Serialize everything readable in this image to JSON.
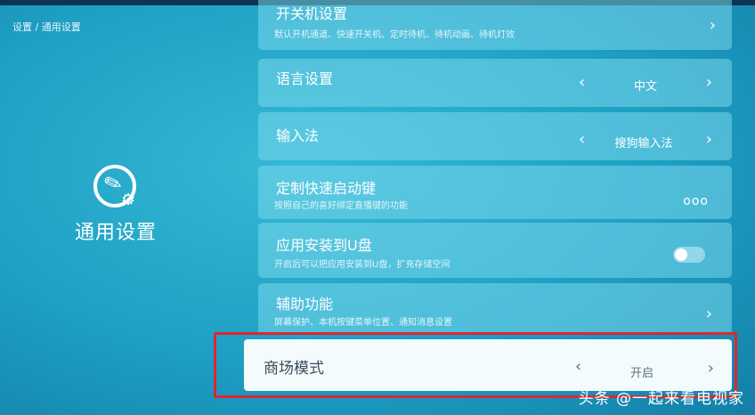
{
  "breadcrumb": "设置 / 通用设置",
  "left_panel": {
    "title": "通用设置",
    "icon": "settings-wrench-gear-icon"
  },
  "items": [
    {
      "title": "开关机设置",
      "subtitle": "默认开机通道、快速开关机、定时待机、待机动画、待机灯效",
      "control": "chevron"
    },
    {
      "title": "语言设置",
      "value": "中文",
      "control": "selector"
    },
    {
      "title": "输入法",
      "value": "搜狗输入法",
      "control": "selector"
    },
    {
      "title": "定制快速启动键",
      "subtitle": "按照自己的喜好绑定直播键的功能",
      "control": "more",
      "more_label": "ooo"
    },
    {
      "title": "应用安装到U盘",
      "subtitle": "开启后可以把应用安装到U盘，扩充存储空间",
      "control": "toggle",
      "toggle_on": false
    },
    {
      "title": "辅助功能",
      "subtitle": "屏幕保护、本机按键菜单位置、通知消息设置",
      "control": "chevron"
    }
  ],
  "focused_item": {
    "title": "商场模式",
    "value": "开启",
    "control": "selector"
  },
  "highlight_color": "#e0262e",
  "watermark": "头条 @一起来看电视家"
}
